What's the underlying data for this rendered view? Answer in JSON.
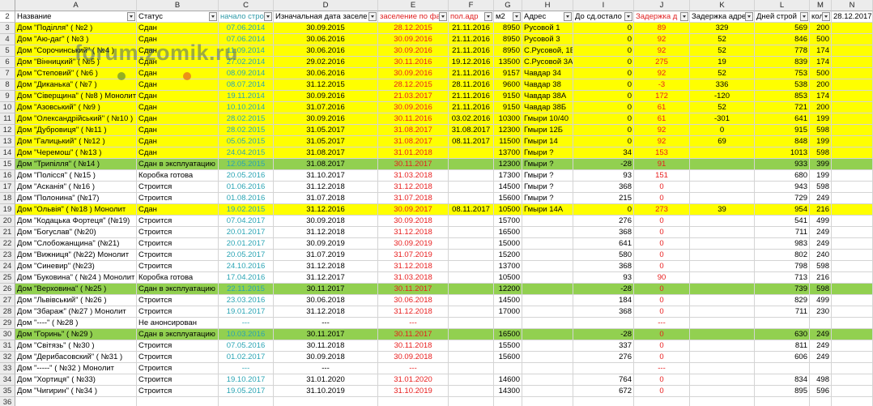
{
  "columns": [
    "A",
    "B",
    "C",
    "D",
    "E",
    "F",
    "G",
    "H",
    "I",
    "J",
    "K",
    "L",
    "M",
    "N"
  ],
  "headers": [
    {
      "text": "Название",
      "dd": true,
      "cls": ""
    },
    {
      "text": "Статус",
      "dd": true,
      "cls": ""
    },
    {
      "text": "начало стро",
      "dd": true,
      "cls": "h-teal"
    },
    {
      "text": "Изначальная дата заселе",
      "dd": true,
      "cls": ""
    },
    {
      "text": "заселение по фа",
      "dd": true,
      "cls": "h-red"
    },
    {
      "text": "пол.адр",
      "dd": true,
      "cls": "h-red"
    },
    {
      "text": "м2",
      "dd": true,
      "cls": ""
    },
    {
      "text": "Адрес",
      "dd": true,
      "cls": ""
    },
    {
      "text": "До сд.остало",
      "dd": true,
      "cls": ""
    },
    {
      "text": "Задержка д",
      "dd": true,
      "cls": "h-red"
    },
    {
      "text": "Задержка адре",
      "dd": true,
      "cls": ""
    },
    {
      "text": "Дней строй",
      "dd": true,
      "cls": ""
    },
    {
      "text": "кол",
      "dd": true,
      "cls": ""
    },
    {
      "text": "28.12.2017",
      "dd": false,
      "cls": ""
    }
  ],
  "rows": [
    {
      "n": "3",
      "hl": "y",
      "v": [
        "Дом \"Поділля\" ( №2 )",
        "Сдан",
        "07.06.2014",
        "30.09.2015",
        "28.12.2015",
        "21.11.2016",
        "8950",
        "Русовой 1",
        "0",
        "89",
        "329",
        "569",
        "200",
        ""
      ]
    },
    {
      "n": "4",
      "hl": "y",
      "v": [
        "Дом \"Аю-даг\" ( №3 )",
        "Сдан",
        "07.06.2014",
        "30.06.2016",
        "30.09.2016",
        "21.11.2016",
        "8950",
        "Русовой 3",
        "0",
        "92",
        "52",
        "846",
        "500",
        ""
      ]
    },
    {
      "n": "5",
      "hl": "y",
      "v": [
        "Дом \"Сорочинський\" ( №4 )",
        "Сдан",
        "11.09.2014",
        "30.06.2016",
        "30.09.2016",
        "21.11.2016",
        "8950",
        "С.Русовой, 1Б",
        "0",
        "92",
        "52",
        "778",
        "174",
        ""
      ]
    },
    {
      "n": "6",
      "hl": "y",
      "v": [
        "Дом \"Вінницкий\" ( №5 )",
        "Сдан",
        "27.02.2014",
        "29.02.2016",
        "30.11.2016",
        "19.12.2016",
        "13500",
        "С.Русовой 3А",
        "0",
        "275",
        "19",
        "839",
        "174",
        ""
      ]
    },
    {
      "n": "7",
      "hl": "y",
      "v": [
        "Дом \"Степовий\" ( №6 )",
        "Сдан",
        "08.09.2014",
        "30.06.2016",
        "30.09.2016",
        "21.11.2016",
        "9157",
        "Чавдар 34",
        "0",
        "92",
        "52",
        "753",
        "500",
        ""
      ]
    },
    {
      "n": "8",
      "hl": "y",
      "v": [
        "Дом \"Диканька\" ( №7 )",
        "Сдан",
        "08.07.2014",
        "31.12.2015",
        "28.12.2015",
        "28.11.2016",
        "9600",
        "Чавдар 38",
        "0",
        "-3",
        "336",
        "538",
        "200",
        ""
      ]
    },
    {
      "n": "9",
      "hl": "y",
      "v": [
        "Дом \"Сіверщина\" ( №8 ) Монолит",
        "Сдан",
        "19.11.2014",
        "30.09.2016",
        "21.03.2017",
        "21.11.2016",
        "9150",
        "Чавдар 38А",
        "0",
        "172",
        "-120",
        "853",
        "174",
        ""
      ]
    },
    {
      "n": "10",
      "hl": "y",
      "v": [
        "Дом \"Азовський\" ( №9 )",
        "Сдан",
        "10.10.2014",
        "31.07.2016",
        "30.09.2016",
        "21.11.2016",
        "9150",
        "Чавдар 38Б",
        "0",
        "61",
        "52",
        "721",
        "200",
        ""
      ]
    },
    {
      "n": "11",
      "hl": "y",
      "v": [
        "Дом \"Олександрійський\" ( №10 )",
        "Сдан",
        "28.02.2015",
        "30.09.2016",
        "30.11.2016",
        "03.02.2016",
        "10300",
        "Гмыри 10/40",
        "0",
        "61",
        "-301",
        "641",
        "199",
        ""
      ]
    },
    {
      "n": "12",
      "hl": "y",
      "v": [
        "Дом \"Дубровиця\" ( №11 )",
        "Сдан",
        "28.02.2015",
        "31.05.2017",
        "31.08.2017",
        "31.08.2017",
        "12300",
        "Гмыри 12Б",
        "0",
        "92",
        "0",
        "915",
        "598",
        ""
      ]
    },
    {
      "n": "13",
      "hl": "y",
      "v": [
        "Дом \"Галицький\" ( №12 )",
        "Сдан",
        "05.05.2015",
        "31.05.2017",
        "31.08.2017",
        "08.11.2017",
        "11500",
        "Гмыри 14",
        "0",
        "92",
        "69",
        "848",
        "199",
        ""
      ]
    },
    {
      "n": "14",
      "hl": "y",
      "v": [
        "Дом \"Черемош\" ( №13 )",
        "Сдан",
        "24.04.2015",
        "31.08.2017",
        "31.01.2018",
        "",
        "13700",
        "Гмыри ?",
        "34",
        "153",
        "",
        "1013",
        "598",
        ""
      ]
    },
    {
      "n": "15",
      "hl": "g",
      "v": [
        "Дом \"Трипілля\" ( №14 )",
        "Сдан в эксплуатацию",
        "12.05.2015",
        "31.08.2017",
        "30.11.2017",
        "",
        "12300",
        "Гмыри ?",
        "-28",
        "91",
        "",
        "933",
        "399",
        ""
      ]
    },
    {
      "n": "16",
      "hl": "",
      "v": [
        "Дом \"Полісся\" ( №15 )",
        "Коробка готова",
        "20.05.2016",
        "31.10.2017",
        "31.03.2018",
        "",
        "17300",
        "Гмыри ?",
        "93",
        "151",
        "",
        "680",
        "199",
        ""
      ]
    },
    {
      "n": "17",
      "hl": "",
      "v": [
        "Дом \"Асканія\" ( №16 )",
        "Строится",
        "01.06.2016",
        "31.12.2018",
        "31.12.2018",
        "",
        "14500",
        "Гмыри ?",
        "368",
        "0",
        "",
        "943",
        "598",
        ""
      ]
    },
    {
      "n": "18",
      "hl": "",
      "v": [
        "Дом \"Полонина\" (№17)",
        "Строится",
        "01.08.2016",
        "31.07.2018",
        "31.07.2018",
        "",
        "15600",
        "Гмыри ?",
        "215",
        "0",
        "",
        "729",
        "249",
        ""
      ]
    },
    {
      "n": "19",
      "hl": "y",
      "v": [
        "Дом \"Ольвія\" ( №18 ) Монолит",
        "Сдан",
        "19.02.2015",
        "31.12.2016",
        "30.09.2017",
        "08.11.2017",
        "10500",
        "Гмыри 14А",
        "0",
        "273",
        "39",
        "954",
        "216",
        ""
      ]
    },
    {
      "n": "20",
      "hl": "",
      "v": [
        "Дом \"Кодацька Фортеця\" (№19)",
        "Строится",
        "07.04.2017",
        "30.09.2018",
        "30.09.2018",
        "",
        "15700",
        "",
        "276",
        "0",
        "",
        "541",
        "499",
        ""
      ]
    },
    {
      "n": "21",
      "hl": "",
      "v": [
        "Дом \"Богуслав\" (№20)",
        "Строится",
        "20.01.2017",
        "31.12.2018",
        "31.12.2018",
        "",
        "16500",
        "",
        "368",
        "0",
        "",
        "711",
        "249",
        ""
      ]
    },
    {
      "n": "22",
      "hl": "",
      "v": [
        "Дом \"Слобожанщина\" (№21)",
        "Строится",
        "20.01.2017",
        "30.09.2019",
        "30.09.2019",
        "",
        "15000",
        "",
        "641",
        "0",
        "",
        "983",
        "249",
        ""
      ]
    },
    {
      "n": "23",
      "hl": "",
      "v": [
        "Дом \"Вижниця\" (№22) Монолит",
        "Строится",
        "20.05.2017",
        "31.07.2019",
        "31.07.2019",
        "",
        "15200",
        "",
        "580",
        "0",
        "",
        "802",
        "240",
        ""
      ]
    },
    {
      "n": "24",
      "hl": "",
      "v": [
        "Дом \"Синевир\" (№23)",
        "Строится",
        "24.10.2016",
        "31.12.2018",
        "31.12.2018",
        "",
        "13700",
        "",
        "368",
        "0",
        "",
        "798",
        "598",
        ""
      ]
    },
    {
      "n": "25",
      "hl": "",
      "v": [
        "Дом \"Буковина\" ( №24 ) Монолит",
        "Коробка готова",
        "17.04.2016",
        "31.12.2017",
        "31.03.2018",
        "",
        "10500",
        "",
        "93",
        "90",
        "",
        "713",
        "216",
        ""
      ]
    },
    {
      "n": "26",
      "hl": "g",
      "v": [
        "Дом \"Верховина\" ( №25 )",
        "Сдан в эксплуатацию",
        "22.11.2015",
        "30.11.2017",
        "30.11.2017",
        "",
        "12200",
        "",
        "-28",
        "0",
        "",
        "739",
        "598",
        ""
      ]
    },
    {
      "n": "27",
      "hl": "",
      "v": [
        "Дом \"Львівський\" ( №26 )",
        "Строится",
        "23.03.2016",
        "30.06.2018",
        "30.06.2018",
        "",
        "14500",
        "",
        "184",
        "0",
        "",
        "829",
        "499",
        ""
      ]
    },
    {
      "n": "28",
      "hl": "",
      "v": [
        "Дом \"Збараж\" (№27 ) Монолит",
        "Строится",
        "19.01.2017",
        "31.12.2018",
        "31.12.2018",
        "",
        "17000",
        "",
        "368",
        "0",
        "",
        "711",
        "230",
        ""
      ]
    },
    {
      "n": "29",
      "hl": "",
      "v": [
        "Дом \"----\" ( №28 )",
        "Не анонсирован",
        "---",
        "---",
        "---",
        "",
        "",
        "",
        "",
        "---",
        "",
        "",
        "",
        ""
      ]
    },
    {
      "n": "30",
      "hl": "g",
      "v": [
        "Дом \"Горинь\" ( №29 )",
        "Сдан в эксплуатацию",
        "10.03.2016",
        "30.11.2017",
        "30.11.2017",
        "",
        "16500",
        "",
        "-28",
        "0",
        "",
        "630",
        "249",
        ""
      ]
    },
    {
      "n": "31",
      "hl": "",
      "v": [
        "Дом \"Світязь\" ( №30 )",
        "Строится",
        "07.05.2016",
        "30.11.2018",
        "30.11.2018",
        "",
        "15500",
        "",
        "337",
        "0",
        "",
        "811",
        "249",
        ""
      ]
    },
    {
      "n": "32",
      "hl": "",
      "v": [
        "Дом \"Дерибасовский\" ( №31 )",
        "Строится",
        "01.02.2017",
        "30.09.2018",
        "30.09.2018",
        "",
        "15600",
        "",
        "276",
        "0",
        "",
        "606",
        "249",
        ""
      ]
    },
    {
      "n": "33",
      "hl": "",
      "v": [
        "Дом \"-----\" ( №32 ) Монолит",
        "Строится",
        "---",
        "---",
        "---",
        "",
        "",
        "",
        "",
        "---",
        "",
        "",
        "",
        ""
      ]
    },
    {
      "n": "34",
      "hl": "",
      "v": [
        "Дом \"Хортиця\" ( №33)",
        "Строится",
        "19.10.2017",
        "31.01.2020",
        "31.01.2020",
        "",
        "14600",
        "",
        "764",
        "0",
        "",
        "834",
        "498",
        ""
      ]
    },
    {
      "n": "35",
      "hl": "",
      "v": [
        "Дом \"Чигирин\" ( №34 )",
        "Строится",
        "19.05.2017",
        "31.10.2019",
        "31.10.2019",
        "",
        "14300",
        "",
        "672",
        "0",
        "",
        "895",
        "596",
        ""
      ]
    },
    {
      "n": "36",
      "hl": "",
      "v": [
        "",
        "",
        "",
        "",
        "",
        "",
        "",
        "",
        "",
        "",
        "",
        "",
        "",
        ""
      ]
    }
  ],
  "watermark": "forum.zomik.ru",
  "colors": {
    "yellow": "#ffff00",
    "green": "#92d050",
    "teal": "#2aa4b4",
    "red": "#e81d1d"
  }
}
